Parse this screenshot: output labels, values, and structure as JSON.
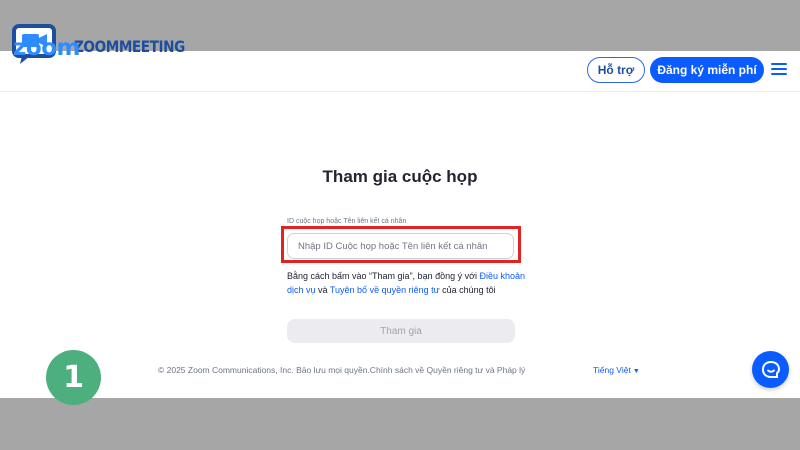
{
  "branding": {
    "watermark_text": "ZOOMMEETING",
    "logo_text": "zoom",
    "logo_icon": "video-camera-icon"
  },
  "header": {
    "support_label": "Hỗ trợ",
    "signup_label": "Đăng ký miễn phí",
    "menu_icon": "hamburger-menu-icon"
  },
  "form": {
    "title": "Tham gia cuộc họp",
    "field_label": "ID cuộc họp hoặc Tên liên kết cá nhân",
    "input_placeholder": "Nhập ID Cuộc họp hoặc Tên liên kết cá nhân",
    "input_value": "",
    "terms_prefix": "Bằng cách bấm vào “Tham gia”, bạn đồng ý với ",
    "terms_link1": "Điều khoản dịch vụ",
    "terms_mid": " và ",
    "terms_link2": "Tuyên bố về quyền riêng tư",
    "terms_suffix": " của chúng tôi",
    "join_label": "Tham gia"
  },
  "footer": {
    "copyright": "© 2025 Zoom Communications, Inc. Bảo lưu mọi quyền.Chính sách về Quyền riêng tư và Pháp lý",
    "language": "Tiếng Việt"
  },
  "overlay": {
    "step_number": "1",
    "highlight_color": "#e02424",
    "badge_color": "#4caf7d"
  },
  "colors": {
    "brand_blue": "#0b5cff",
    "background_band": "#a6a6a6"
  }
}
